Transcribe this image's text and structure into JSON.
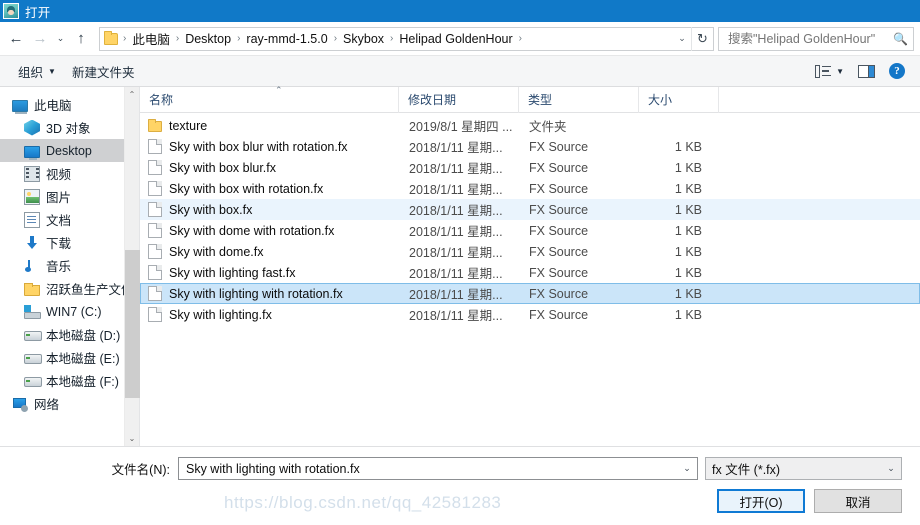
{
  "window": {
    "title": "打开",
    "icon": "app-avatar-icon"
  },
  "nav": {
    "back": "←",
    "forward": "→",
    "recent": "⌄",
    "up": "↑",
    "refresh": "↻"
  },
  "address": {
    "crumbs": [
      "此电脑",
      "Desktop",
      "ray-mmd-1.5.0",
      "Skybox",
      "Helipad GoldenHour"
    ],
    "separator": "›",
    "dropdown": "⌄"
  },
  "search": {
    "placeholder": "搜索\"Helipad GoldenHour\"",
    "value": "",
    "icon": "search-icon"
  },
  "toolbar": {
    "organize": "组织",
    "organize_caret": "▼",
    "new_folder": "新建文件夹",
    "view_caret": "▼",
    "help": "?"
  },
  "sidebar": {
    "items": [
      {
        "label": "此电脑",
        "icon": "computer-icon",
        "indent": false,
        "selected": false
      },
      {
        "label": "3D 对象",
        "icon": "3d-objects-icon",
        "indent": true,
        "selected": false
      },
      {
        "label": "Desktop",
        "icon": "desktop-icon",
        "indent": true,
        "selected": true
      },
      {
        "label": "视频",
        "icon": "videos-icon",
        "indent": true,
        "selected": false
      },
      {
        "label": "图片",
        "icon": "pictures-icon",
        "indent": true,
        "selected": false
      },
      {
        "label": "文档",
        "icon": "documents-icon",
        "indent": true,
        "selected": false
      },
      {
        "label": "下载",
        "icon": "downloads-icon",
        "indent": true,
        "selected": false
      },
      {
        "label": "音乐",
        "icon": "music-icon",
        "indent": true,
        "selected": false
      },
      {
        "label": "沼跃鱼生产文件",
        "icon": "folder-icon",
        "indent": true,
        "selected": false
      },
      {
        "label": "WIN7 (C:)",
        "icon": "windows-drive-icon",
        "indent": true,
        "selected": false
      },
      {
        "label": "本地磁盘 (D:)",
        "icon": "drive-icon",
        "indent": true,
        "selected": false
      },
      {
        "label": "本地磁盘 (E:)",
        "icon": "drive-icon",
        "indent": true,
        "selected": false
      },
      {
        "label": "本地磁盘 (F:)",
        "icon": "drive-icon",
        "indent": true,
        "selected": false
      },
      {
        "label": "网络",
        "icon": "network-icon",
        "indent": false,
        "selected": false
      }
    ],
    "scroll_up": "⌃",
    "scroll_down": "⌄"
  },
  "filelist": {
    "columns": [
      "名称",
      "修改日期",
      "类型",
      "大小"
    ],
    "sort_indicator": "⌃",
    "rows": [
      {
        "name": "texture",
        "date": "2019/8/1 星期四 ...",
        "type": "文件夹",
        "size": "",
        "icon": "folder-icon",
        "state": ""
      },
      {
        "name": "Sky with box blur with rotation.fx",
        "date": "2018/1/11 星期...",
        "type": "FX Source",
        "size": "1 KB",
        "icon": "file-icon",
        "state": ""
      },
      {
        "name": "Sky with box blur.fx",
        "date": "2018/1/11 星期...",
        "type": "FX Source",
        "size": "1 KB",
        "icon": "file-icon",
        "state": ""
      },
      {
        "name": "Sky with box with rotation.fx",
        "date": "2018/1/11 星期...",
        "type": "FX Source",
        "size": "1 KB",
        "icon": "file-icon",
        "state": ""
      },
      {
        "name": "Sky with box.fx",
        "date": "2018/1/11 星期...",
        "type": "FX Source",
        "size": "1 KB",
        "icon": "file-icon",
        "state": "hover"
      },
      {
        "name": "Sky with dome with rotation.fx",
        "date": "2018/1/11 星期...",
        "type": "FX Source",
        "size": "1 KB",
        "icon": "file-icon",
        "state": ""
      },
      {
        "name": "Sky with dome.fx",
        "date": "2018/1/11 星期...",
        "type": "FX Source",
        "size": "1 KB",
        "icon": "file-icon",
        "state": ""
      },
      {
        "name": "Sky with lighting fast.fx",
        "date": "2018/1/11 星期...",
        "type": "FX Source",
        "size": "1 KB",
        "icon": "file-icon",
        "state": ""
      },
      {
        "name": "Sky with lighting with rotation.fx",
        "date": "2018/1/11 星期...",
        "type": "FX Source",
        "size": "1 KB",
        "icon": "file-icon",
        "state": "selected"
      },
      {
        "name": "Sky with lighting.fx",
        "date": "2018/1/11 星期...",
        "type": "FX Source",
        "size": "1 KB",
        "icon": "file-icon",
        "state": ""
      }
    ]
  },
  "footer": {
    "filename_label": "文件名(N):",
    "filename_value": "Sky with lighting with rotation.fx",
    "filename_caret": "⌄",
    "filetype_value": "fx 文件 (*.fx)",
    "filetype_caret": "⌄",
    "open_button": "打开(O)",
    "cancel_button": "取消"
  },
  "watermark": "https://blog.csdn.net/qq_42581283",
  "colors": {
    "titlebar": "#1079c8",
    "selection": "#cbe5f9",
    "hover": "#eaf4fd",
    "accent": "#0f7ad4"
  }
}
